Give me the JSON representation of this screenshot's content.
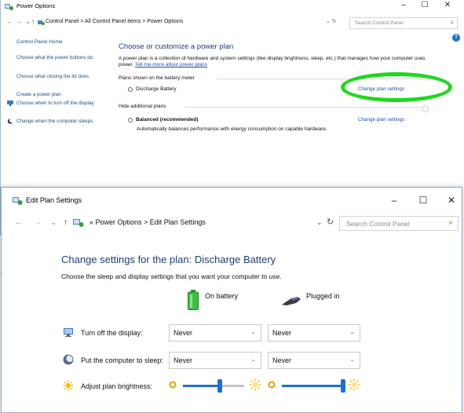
{
  "colors": {
    "accent": "#1a6fd6",
    "heading": "#1f3d7a",
    "link": "#1a4fb0",
    "highlight": "#1ed81e"
  },
  "power_options_window": {
    "title": "Power Options",
    "controls": {
      "minimize": "–",
      "maximize": "☐",
      "close": "✕"
    },
    "address": {
      "nav": {
        "back": "←",
        "forward": "→",
        "recent": "⌄",
        "up": "↑"
      },
      "crumbs": "Control Panel  >  All Control Panel Items  >  Power Options",
      "dropdown": "⌄ ↻",
      "search_placeholder": "Search Control Panel",
      "search_icon": "⌕"
    },
    "help_icon": "?",
    "sidebar": {
      "home": "Control Panel Home",
      "links": [
        {
          "label": "Choose what the power buttons do",
          "icon": ""
        },
        {
          "label": "Choose what closing the lid does",
          "icon": ""
        },
        {
          "label": "Create a power plan",
          "icon": ""
        },
        {
          "label": "Choose when to turn off the display",
          "icon": "monitor-icon"
        },
        {
          "label": "Change when the computer sleeps",
          "icon": "moon-icon"
        }
      ]
    },
    "main": {
      "heading": "Choose or customize a power plan",
      "description": "A power plan is a collection of hardware and system settings (like display brightness, sleep, etc.) that manages how your computer uses power.",
      "learn_more": "Tell me more about power plans",
      "group_battery_meter": "Plans shown on the battery meter",
      "plan_discharge": "Discharge Battery",
      "change_plan_settings_1": "Change plan settings",
      "group_hide": "Hide additional plans",
      "plan_balanced": "Balanced (recommended)",
      "change_plan_settings_2": "Change plan settings",
      "balanced_desc": "Automatically balances performance with energy consumption on capable hardware."
    }
  },
  "edit_plan_window": {
    "title": "Edit Plan Settings",
    "controls": {
      "minimize": "–",
      "maximize": "☐",
      "close": "✕"
    },
    "address": {
      "nav": {
        "back": "←",
        "forward": "→",
        "recent": "⌄",
        "up": "↑"
      },
      "crumbs": "«  Power Options  >  Edit Plan Settings",
      "dropdown": "⌄",
      "refresh": "↻",
      "search_placeholder": "Search Control Panel",
      "search_icon": "⌕"
    },
    "heading": "Change settings for the plan: Discharge Battery",
    "subheading": "Choose the sleep and display settings that you want your computer to use.",
    "columns": {
      "on_battery": "On battery",
      "plugged_in": "Plugged in"
    },
    "rows": [
      {
        "label": "Turn off the display:",
        "on_battery": "Never",
        "plugged_in": "Never",
        "icon": "display-icon"
      },
      {
        "label": "Put the computer to sleep:",
        "on_battery": "Never",
        "plugged_in": "Never",
        "icon": "sleep-icon"
      }
    ],
    "brightness": {
      "label": "Adjust plan brightness:",
      "on_battery_level": 0.6,
      "plugged_in_level": 1.0
    },
    "chevron": "⌄"
  }
}
